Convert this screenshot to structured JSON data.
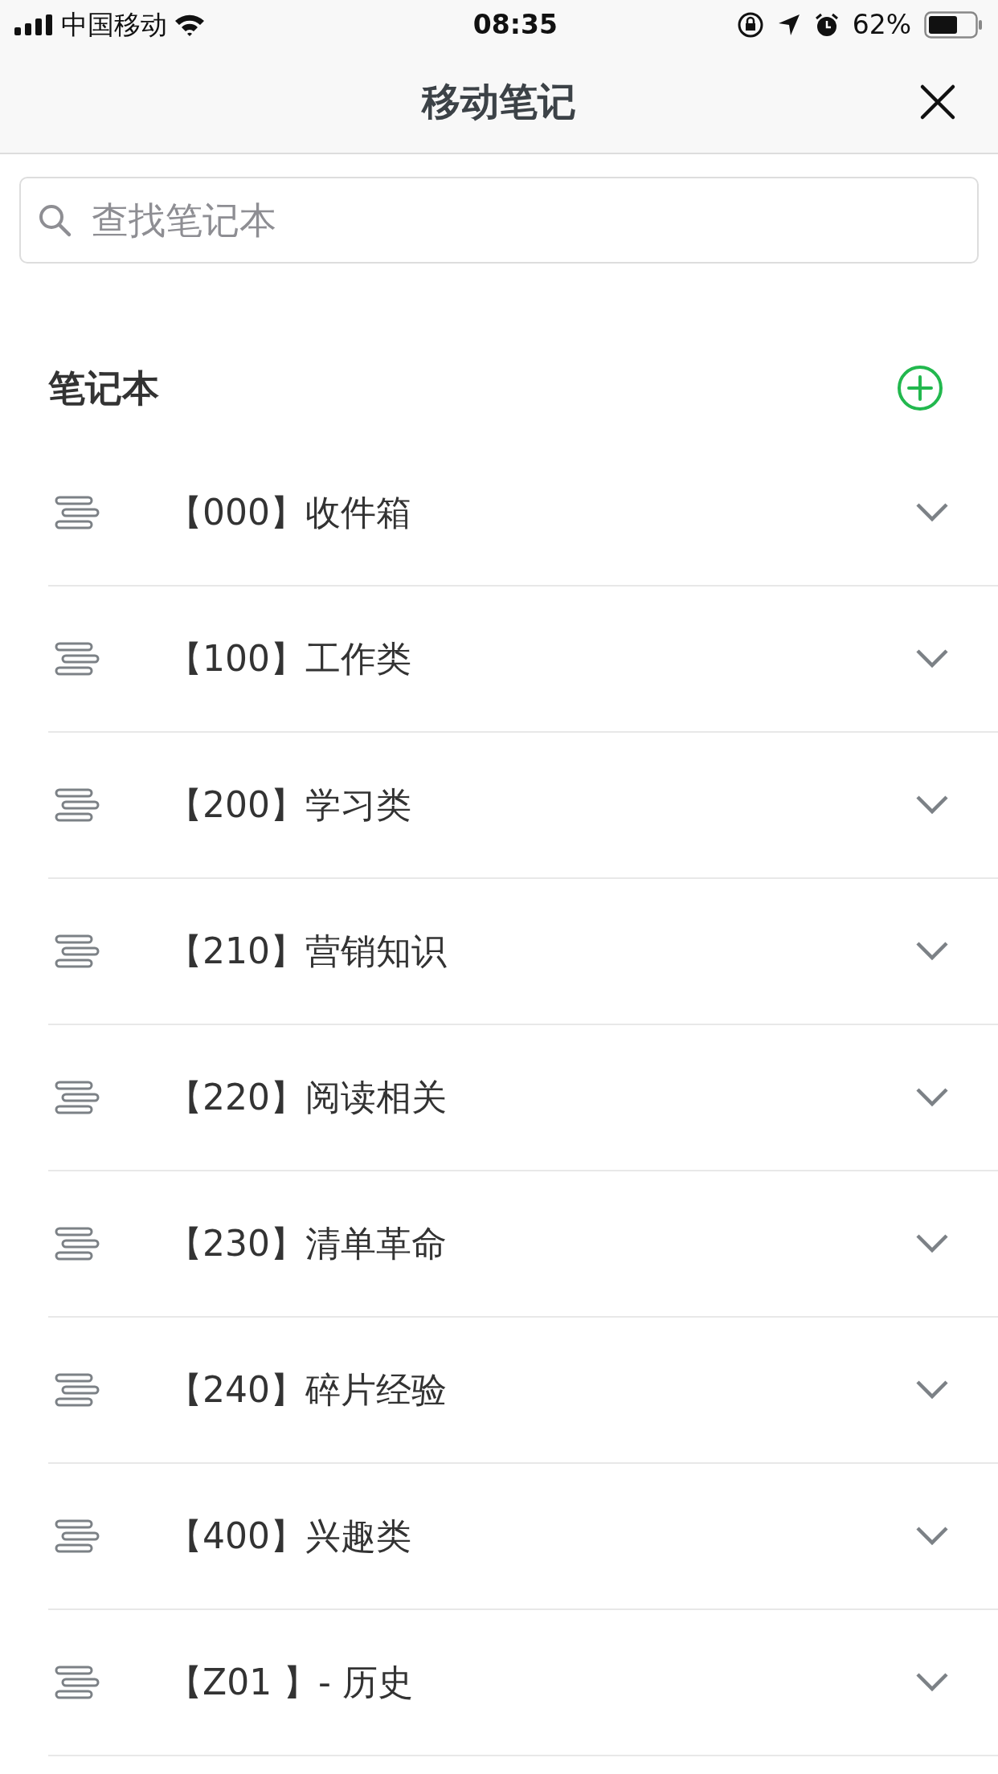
{
  "status_bar": {
    "carrier": "中国移动",
    "time": "08:35",
    "battery_percent": "62%"
  },
  "header": {
    "title": "移动笔记"
  },
  "search": {
    "placeholder": "查找笔记本"
  },
  "section": {
    "title": "笔记本"
  },
  "notebooks": [
    {
      "label": "【000】收件箱",
      "expanded": false
    },
    {
      "label": "【100】工作类",
      "expanded": false
    },
    {
      "label": "【200】学习类",
      "expanded": false
    },
    {
      "label": "【210】营销知识",
      "expanded": false
    },
    {
      "label": "【220】阅读相关",
      "expanded": false
    },
    {
      "label": "【230】清单革命",
      "expanded": false
    },
    {
      "label": "【240】碎片经验",
      "expanded": false
    },
    {
      "label": "【400】兴趣类",
      "expanded": false
    },
    {
      "label": "【Z01 】- 历史",
      "expanded": false
    }
  ]
}
